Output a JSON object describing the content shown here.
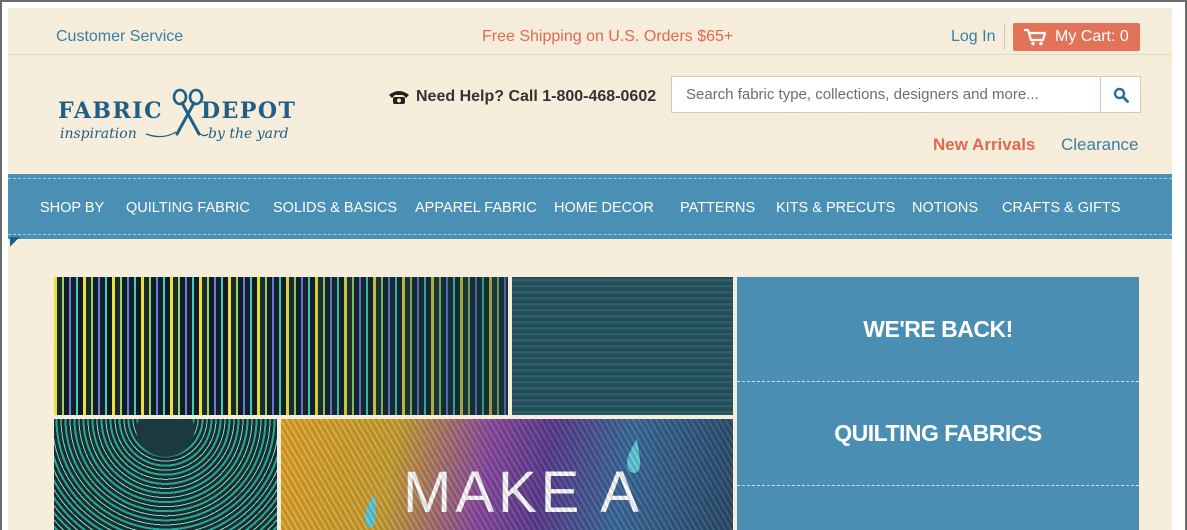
{
  "topbar": {
    "customer_service": "Customer Service",
    "shipping_notice": "Free Shipping on U.S. Orders $65+",
    "login": "Log In",
    "cart_label": "My Cart: 0"
  },
  "header": {
    "logo_title": "FABRIC DEPOT",
    "logo_tagline_left": "inspiration",
    "logo_tagline_right": "by the yard",
    "help_text": "Need Help? Call 1-800-468-0602",
    "search_placeholder": "Search fabric type, collections, designers and more...",
    "new_arrivals": "New Arrivals",
    "clearance": "Clearance"
  },
  "nav": {
    "items": [
      {
        "label": "SHOP BY"
      },
      {
        "label": "QUILTING FABRIC"
      },
      {
        "label": "SOLIDS & BASICS"
      },
      {
        "label": "APPAREL FABRIC"
      },
      {
        "label": "HOME DECOR"
      },
      {
        "label": "PATTERNS"
      },
      {
        "label": "KITS & PRECUTS"
      },
      {
        "label": "NOTIONS"
      },
      {
        "label": "CRAFTS & GIFTS"
      }
    ]
  },
  "hero": {
    "banner_text": "MAKE A",
    "panel": {
      "headline": "WE'RE BACK!",
      "subhead": "QUILTING FABRICS"
    }
  },
  "colors": {
    "accent_blue": "#4a90b5",
    "accent_orange": "#e27358",
    "link_blue": "#3a7fa6",
    "background_cream": "#f5ecd9"
  },
  "icons": {
    "cart": "cart-icon",
    "phone": "phone-icon",
    "search": "search-icon",
    "logo_scissors": "scissors-icon"
  }
}
